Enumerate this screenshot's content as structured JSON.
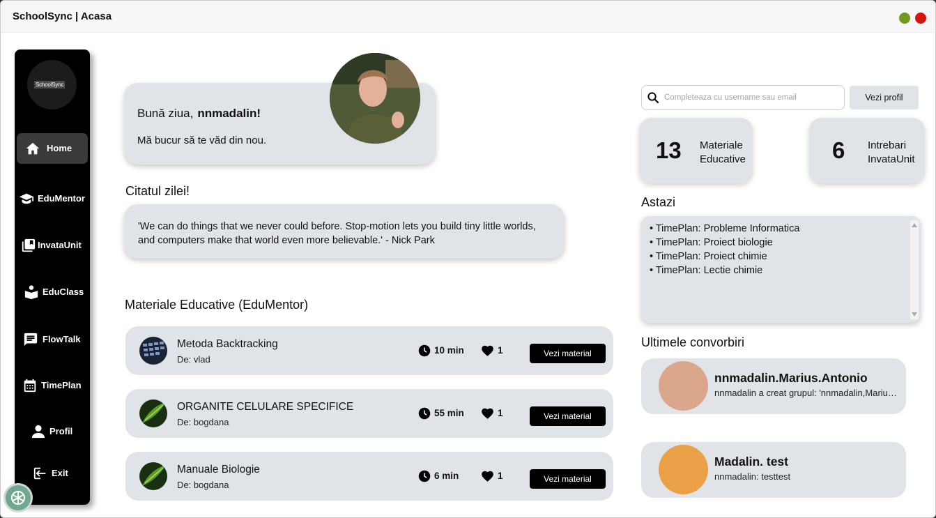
{
  "window": {
    "title": "SchoolSync | Acasa"
  },
  "sidebar": {
    "logo_text": "SchoolSync",
    "items": [
      {
        "label": "Home",
        "icon": "home-icon",
        "active": true
      },
      {
        "label": "EduMentor",
        "icon": "graduation-cap-icon"
      },
      {
        "label": "InvataUnit",
        "icon": "book-icon"
      },
      {
        "label": "EduClass",
        "icon": "reader-icon"
      },
      {
        "label": "FlowTalk",
        "icon": "chat-icon"
      },
      {
        "label": "TimePlan",
        "icon": "calendar-icon"
      },
      {
        "label": "Profil",
        "icon": "user-icon"
      },
      {
        "label": "Exit",
        "icon": "logout-icon"
      }
    ]
  },
  "greeting": {
    "hello": "Bună ziua,",
    "username": "nnmadalin!",
    "subtitle": "Mă bucur să te văd din nou."
  },
  "quote": {
    "title": "Citatul zilei!",
    "text": "'We can do things that we never could before. Stop-motion lets you build tiny little worlds, and computers make that world even more believable.' - Nick Park"
  },
  "materials": {
    "title": "Materiale Educative (EduMentor)",
    "button_label": "Vezi material",
    "items": [
      {
        "title": "Metoda Backtracking",
        "author": "De: vlad",
        "time": "10 min",
        "likes": "1"
      },
      {
        "title": "ORGANITE CELULARE SPECIFICE",
        "author": "De: bogdana",
        "time": "55 min",
        "likes": "1"
      },
      {
        "title": "Manuale Biologie",
        "author": "De: bogdana",
        "time": "6 min",
        "likes": "1"
      }
    ]
  },
  "search": {
    "placeholder": "Completeaza cu username sau email",
    "button_label": "Vezi profil"
  },
  "stats": [
    {
      "value": "13",
      "label_line1": "Materiale",
      "label_line2": "Educative"
    },
    {
      "value": "6",
      "label_line1": "Intrebari",
      "label_line2": "InvataUnit"
    }
  ],
  "today": {
    "title": "Astazi",
    "items": [
      "TimePlan: Probleme Informatica",
      "TimePlan: Proiect biologie",
      "TimePlan: Proiect chimie",
      "TimePlan: Lectie chimie"
    ]
  },
  "conversations": {
    "title": "Ultimele convorbiri",
    "items": [
      {
        "name": "nnmadalin.Marius.Antonio",
        "message": "nnmadalin a creat grupul: 'nnmadalin,Marius.Antonio'",
        "color": "#dba78c"
      },
      {
        "name": "Madalin. test",
        "message": "nnmadalin: testtest",
        "color": "#e9a047"
      }
    ]
  },
  "colors": {
    "card_bg": "#e0e4e8",
    "sidebar_bg": "#000000",
    "minimize": "#6f9a1c",
    "close": "#d8140f"
  }
}
